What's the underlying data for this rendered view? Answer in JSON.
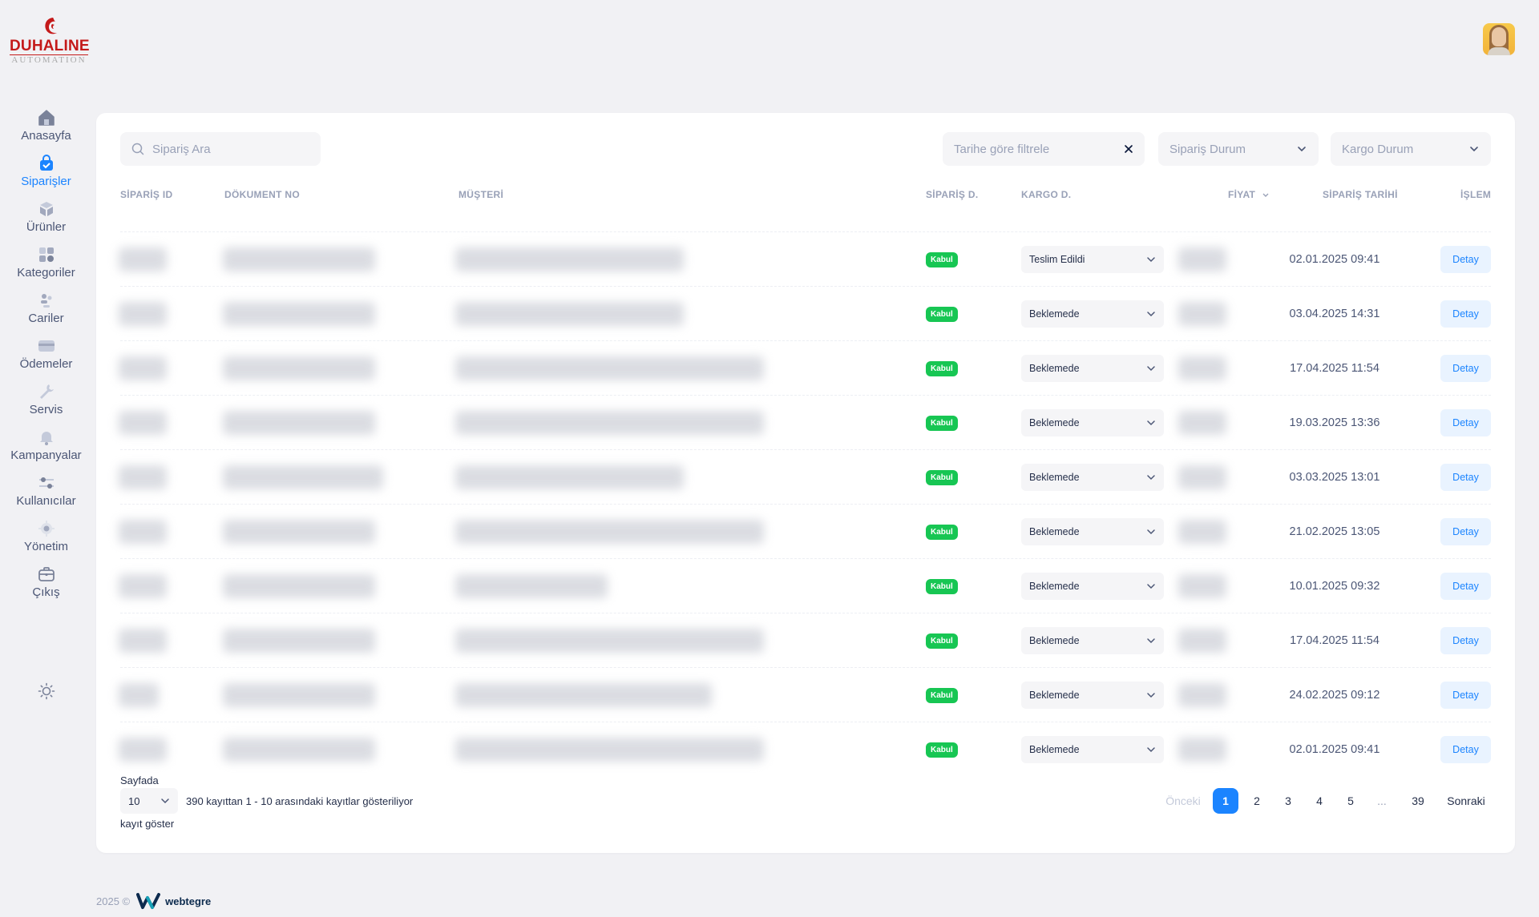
{
  "logo": {
    "brand": "DUHALINE",
    "sub": "AUTOMATION"
  },
  "sidebar": {
    "items": [
      {
        "label": "Anasayfa",
        "icon": "home-icon"
      },
      {
        "label": "Siparişler",
        "icon": "basket-icon",
        "active": true
      },
      {
        "label": "Ürünler",
        "icon": "box-icon"
      },
      {
        "label": "Kategoriler",
        "icon": "category-icon"
      },
      {
        "label": "Cariler",
        "icon": "people-icon"
      },
      {
        "label": "Ödemeler",
        "icon": "card-icon"
      },
      {
        "label": "Servis",
        "icon": "wrench-icon"
      },
      {
        "label": "Kampanyalar",
        "icon": "notification-icon"
      },
      {
        "label": "Kullanıcılar",
        "icon": "sliders-icon"
      },
      {
        "label": "Yönetim",
        "icon": "gear-icon"
      },
      {
        "label": "Çıkış",
        "icon": "briefcase-icon"
      }
    ],
    "theme_icon": "sun-icon"
  },
  "toolbar": {
    "search_placeholder": "Sipariş Ara",
    "date_filter": "Tarihe göre filtrele",
    "siparis_filter": "Sipariş Durum",
    "kargo_filter": "Kargo Durum"
  },
  "table": {
    "headers": {
      "siparis_id": "SİPARİŞ ID",
      "dokument_no": "DÖKUMENT NO",
      "musteri": "MÜŞTERİ",
      "siparis_d": "SİPARİŞ D.",
      "kargo_d": "KARGO D.",
      "fiyat": "FİYAT",
      "siparis_tarihi": "SİPARİŞ TARİHİ",
      "islem": "İŞLEM"
    },
    "rows": [
      {
        "status": "Kabul",
        "kargo": "Teslim Edildi",
        "date": "02.01.2025 09:41",
        "action": "Detay"
      },
      {
        "status": "Kabul",
        "kargo": "Beklemede",
        "date": "03.04.2025 14:31",
        "action": "Detay"
      },
      {
        "status": "Kabul",
        "kargo": "Beklemede",
        "date": "17.04.2025 11:54",
        "action": "Detay"
      },
      {
        "status": "Kabul",
        "kargo": "Beklemede",
        "date": "19.03.2025 13:36",
        "action": "Detay"
      },
      {
        "status": "Kabul",
        "kargo": "Beklemede",
        "date": "03.03.2025 13:01",
        "action": "Detay"
      },
      {
        "status": "Kabul",
        "kargo": "Beklemede",
        "date": "21.02.2025 13:05",
        "action": "Detay"
      },
      {
        "status": "Kabul",
        "kargo": "Beklemede",
        "date": "10.01.2025 09:32",
        "action": "Detay"
      },
      {
        "status": "Kabul",
        "kargo": "Beklemede",
        "date": "17.04.2025 11:54",
        "action": "Detay"
      },
      {
        "status": "Kabul",
        "kargo": "Beklemede",
        "date": "24.02.2025 09:12",
        "action": "Detay"
      },
      {
        "status": "Kabul",
        "kargo": "Beklemede",
        "date": "02.01.2025 09:41",
        "action": "Detay"
      }
    ]
  },
  "pagination": {
    "per_page_label_top": "Sayfada",
    "per_page_value": "10",
    "per_page_label_bottom": "kayıt göster",
    "showing": "390 kayıttan 1 - 10 arasındaki kayıtlar gösteriliyor",
    "prev": "Önceki",
    "pages": [
      "1",
      "2",
      "3",
      "4",
      "5",
      "...",
      "39"
    ],
    "active_page": "1",
    "next": "Sonraki"
  },
  "footer": {
    "year": "2025 ©",
    "brand": "webtegre"
  },
  "colors": {
    "primary": "#1b84ff",
    "success": "#17c653",
    "brand_red": "#c41a1a"
  }
}
